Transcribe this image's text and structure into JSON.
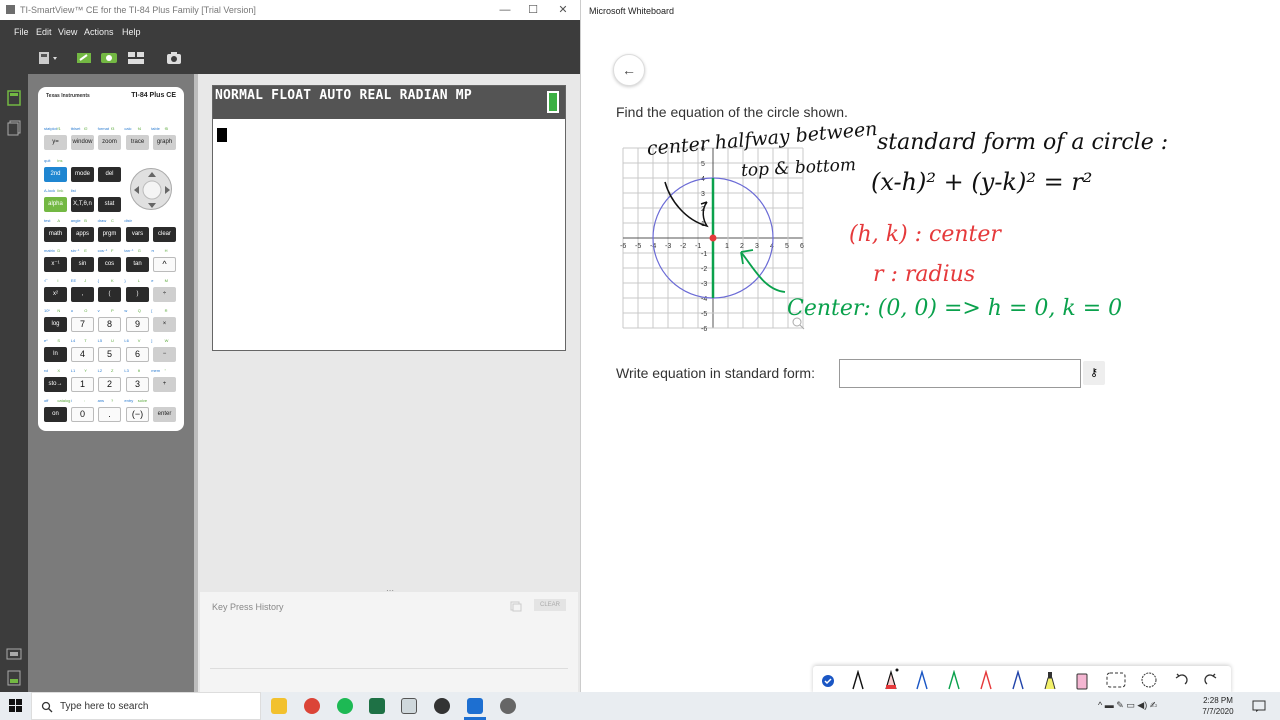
{
  "ti": {
    "window_title": "TI-SmartView™ CE for the TI-84 Plus Family [Trial Version]",
    "controls": {
      "minimize": "—",
      "maximize": "☐",
      "close": "✕"
    },
    "menu": [
      "File",
      "Edit",
      "View",
      "Actions",
      "Help"
    ],
    "brand": "Texas Instruments",
    "model": "TI-84 Plus CE",
    "screen_status": "NORMAL FLOAT AUTO REAL RADIAN MP",
    "key_press_history_label": "Key Press History",
    "clear_label": "CLEAR",
    "keys": {
      "row1": [
        "y=",
        "window",
        "zoom",
        "trace",
        "graph"
      ],
      "row1_labels": [
        "statplot",
        "f1",
        "tblset",
        "f2",
        "format",
        "f3",
        "calc",
        "f4",
        "table",
        "f5"
      ],
      "row2": [
        "2nd",
        "mode",
        "del"
      ],
      "row2_labels": [
        "quit",
        "ins"
      ],
      "row3": [
        "alpha",
        "X,T,θ,n",
        "stat"
      ],
      "row3_labels": [
        "A-lock",
        "link",
        "list"
      ],
      "row4": [
        "math",
        "apps",
        "prgm",
        "vars",
        "clear"
      ],
      "row4_labels": [
        "test",
        "A",
        "angle",
        "B",
        "draw",
        "C",
        "distr"
      ],
      "row5": [
        "x⁻¹",
        "sin",
        "cos",
        "tan",
        "^"
      ],
      "row5_labels": [
        "matrix",
        "D",
        "sin⁻¹",
        "E",
        "cos⁻¹",
        "F",
        "tan⁻¹",
        "G",
        "π",
        "H"
      ],
      "row6": [
        "x²",
        ",",
        "(",
        ")",
        "÷"
      ],
      "row6_labels": [
        "√‾",
        "I",
        "EE",
        "J",
        "{",
        "K",
        "}",
        "L",
        "e",
        "M"
      ],
      "row7": [
        "log",
        "7",
        "8",
        "9",
        "×"
      ],
      "row7_labels": [
        "10ˣ",
        "N",
        "u",
        "O",
        "v",
        "P",
        "w",
        "Q",
        "[",
        "R"
      ],
      "row8": [
        "ln",
        "4",
        "5",
        "6",
        "−"
      ],
      "row8_labels": [
        "eˣ",
        "S",
        "L4",
        "T",
        "L5",
        "U",
        "L6",
        "V",
        "]",
        "W"
      ],
      "row9": [
        "sto→",
        "1",
        "2",
        "3",
        "+"
      ],
      "row9_labels": [
        "rcl",
        "X",
        "L1",
        "Y",
        "L2",
        "Z",
        "L3",
        "θ",
        "mem",
        "\""
      ],
      "row10": [
        "on",
        "0",
        ".",
        "(−)",
        "enter"
      ],
      "row10_labels": [
        "off",
        "catalog",
        "i",
        ":",
        "ans",
        "?",
        "entry",
        "solve"
      ]
    }
  },
  "wb": {
    "app_title": "Microsoft Whiteboard",
    "back_icon": "←",
    "question": "Find the equation of the circle shown.",
    "prompt": "Write equation in standard form:",
    "answer_value": "",
    "key_icon": "⚷",
    "graph": {
      "x_ticks": [
        "-6",
        "-5",
        "-4",
        "-3",
        "-2",
        "-1",
        "1",
        "2",
        "3",
        "4",
        "5",
        "6"
      ],
      "y_ticks": [
        "6",
        "5",
        "4",
        "3",
        "2",
        "1",
        "-1",
        "-2",
        "-3",
        "-4",
        "-5",
        "-6"
      ],
      "circle_radius": 4
    },
    "ink": {
      "note1": "center halfway between",
      "note2": "top & bottom",
      "std1": "standard form of a circle :",
      "std2": "(x-h)² + (y-k)² = r²",
      "hk": "(h, k) : center",
      "r": "r : radius",
      "center": "Center: (0, 0) => h = 0, k = 0"
    },
    "colors": {
      "ink_black": "#111111",
      "ink_red": "#e5393b",
      "ink_green": "#0aa14c",
      "circle": "#6b6bd6"
    }
  },
  "taskbar": {
    "search_placeholder": "Type here to search",
    "time": "2:28 PM",
    "date": "7/7/2020"
  }
}
